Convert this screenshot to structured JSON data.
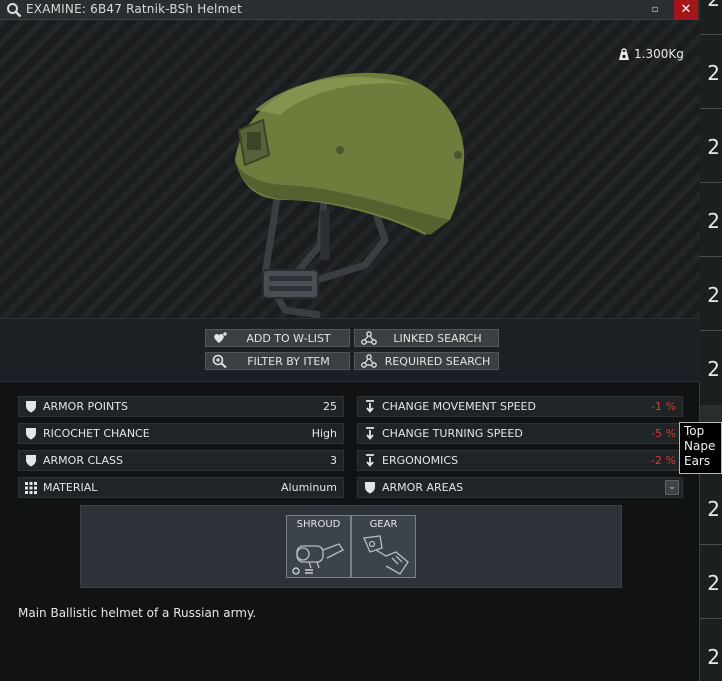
{
  "window": {
    "title": "EXAMINE: 6B47 Ratnik-BSh Helmet",
    "minimize_label": "▫",
    "close_label": "✕"
  },
  "item": {
    "weight": "1.300Kg",
    "description": "Main Ballistic helmet of a Russian army."
  },
  "actions": {
    "add_to_wlist": "ADD TO W-LIST",
    "linked_search": "LINKED SEARCH",
    "filter_by_item": "FILTER BY ITEM",
    "required_search": "REQUIRED SEARCH"
  },
  "stats_left": [
    {
      "label": "ARMOR POINTS",
      "value": "25",
      "icon": "shield-icon"
    },
    {
      "label": "RICOCHET CHANCE",
      "value": "High",
      "icon": "shield-icon"
    },
    {
      "label": "ARMOR CLASS",
      "value": "3",
      "icon": "shield-icon"
    },
    {
      "label": "MATERIAL",
      "value": "Aluminum",
      "icon": "grid-icon"
    }
  ],
  "stats_right": [
    {
      "label": "CHANGE MOVEMENT SPEED",
      "value": "-1 %",
      "icon": "arrow-down-icon"
    },
    {
      "label": "CHANGE TURNING SPEED",
      "value": "-5 %",
      "icon": "arrow-down-icon"
    },
    {
      "label": "ERGONOMICS",
      "value": "-2 %",
      "icon": "arrow-down-icon"
    },
    {
      "label": "ARMOR AREAS",
      "value": "",
      "icon": "shield-icon"
    }
  ],
  "armor_areas_dropdown": "⌄",
  "tooltip": [
    "Top",
    "Nape",
    "Ears"
  ],
  "mod_slots": [
    {
      "label": "SHROUD"
    },
    {
      "label": "GEAR"
    }
  ],
  "side_strip": [
    "2",
    "2",
    "2",
    "2",
    "2",
    "2",
    "2",
    "2",
    "2"
  ],
  "colors": {
    "close_red": "#a81518",
    "negative": "#d53c32",
    "helmet_green": "#6e7d3c"
  }
}
